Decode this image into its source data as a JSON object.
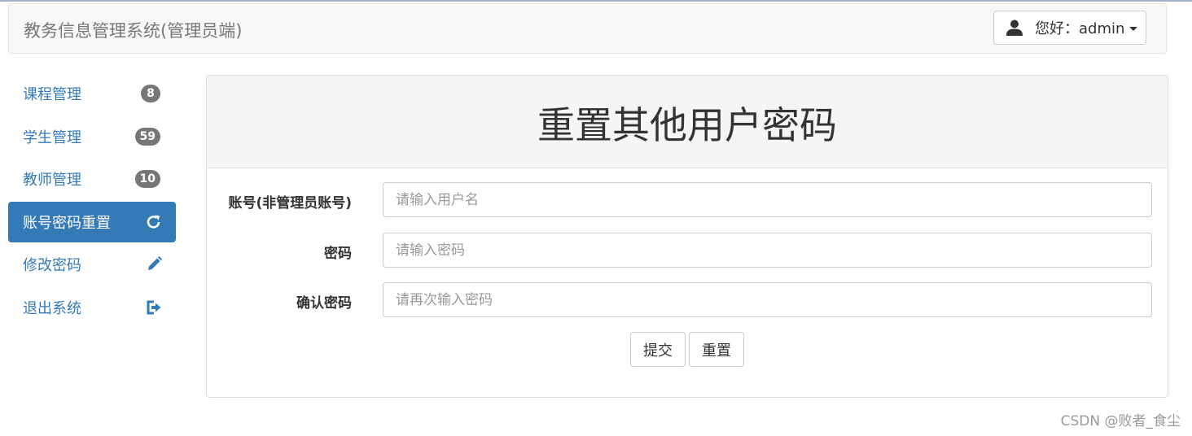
{
  "header": {
    "brand": "教务信息管理系统(管理员端)",
    "user_greeting": "您好：admin"
  },
  "sidebar": {
    "items": [
      {
        "label": "课程管理",
        "badge": "8"
      },
      {
        "label": "学生管理",
        "badge": "59"
      },
      {
        "label": "教师管理",
        "badge": "10"
      },
      {
        "label": "账号密码重置",
        "icon": "refresh-icon",
        "active": true
      },
      {
        "label": "修改密码",
        "icon": "pencil-icon"
      },
      {
        "label": "退出系统",
        "icon": "logout-icon"
      }
    ]
  },
  "panel": {
    "title": "重置其他用户密码",
    "fields": [
      {
        "label": "账号(非管理员账号)",
        "placeholder": "请输入用户名"
      },
      {
        "label": "密码",
        "placeholder": "请输入密码"
      },
      {
        "label": "确认密码",
        "placeholder": "请再次输入密码"
      }
    ],
    "submit_label": "提交",
    "reset_label": "重置"
  },
  "watermark": "CSDN @败者_食尘",
  "colors": {
    "primary": "#337ab7",
    "badge": "#777777",
    "heading_bg": "#f5f5f5"
  }
}
